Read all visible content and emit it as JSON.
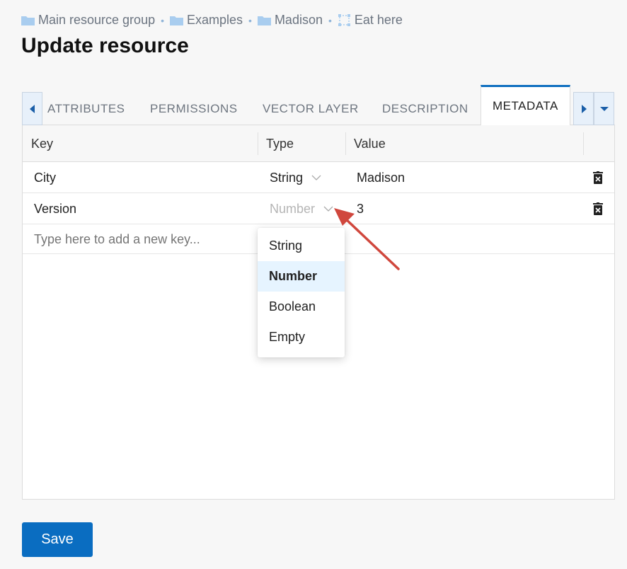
{
  "breadcrumb": {
    "items": [
      {
        "label": "Main resource group",
        "icon": "folder-icon"
      },
      {
        "label": "Examples",
        "icon": "folder-icon"
      },
      {
        "label": "Madison",
        "icon": "folder-icon"
      },
      {
        "label": "Eat here",
        "icon": "vector-layer-icon"
      }
    ],
    "separator": "•"
  },
  "page_title": "Update resource",
  "tabs": {
    "items": [
      {
        "label": "ATTRIBUTES"
      },
      {
        "label": "PERMISSIONS"
      },
      {
        "label": "VECTOR LAYER"
      },
      {
        "label": "DESCRIPTION"
      },
      {
        "label": "METADATA",
        "active": true
      }
    ]
  },
  "table": {
    "columns": [
      "Key",
      "Type",
      "Value"
    ],
    "rows": [
      {
        "key": "City",
        "type": "String",
        "value": "Madison"
      },
      {
        "key": "Version",
        "type": "Number",
        "value": "3"
      }
    ],
    "new_key_placeholder": "Type here to add a new key..."
  },
  "type_dropdown": {
    "options": [
      "String",
      "Number",
      "Boolean",
      "Empty"
    ],
    "selected": "Number"
  },
  "save_label": "Save",
  "colors": {
    "accent": "#0a6dc1",
    "annotation_arrow": "#d0473d",
    "selected_option_bg": "#e6f4ff"
  }
}
